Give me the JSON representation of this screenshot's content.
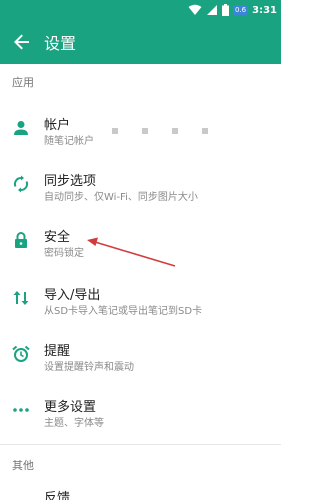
{
  "status_bar": {
    "time": "3:31",
    "badge_text": "0.6",
    "icons": [
      "wifi-icon",
      "signal-icon",
      "battery-icon"
    ]
  },
  "app_bar": {
    "title": "设置",
    "back_icon": "back-arrow-icon",
    "background": "#1aa381"
  },
  "sections": {
    "app_header": "应用",
    "other_header": "其他"
  },
  "settings": [
    {
      "id": "account",
      "icon": "person-icon",
      "title": "帐户",
      "subtitle": "随笔记帐户"
    },
    {
      "id": "sync",
      "icon": "sync-icon",
      "title": "同步选项",
      "subtitle": "自动同步、仅Wi-Fi、同步图片大小"
    },
    {
      "id": "security",
      "icon": "lock-icon",
      "title": "安全",
      "subtitle": "密码锁定"
    },
    {
      "id": "import-export",
      "icon": "import-export-icon",
      "title": "导入/导出",
      "subtitle": "从SD卡导入笔记或导出笔记到SD卡"
    },
    {
      "id": "reminder",
      "icon": "alarm-icon",
      "title": "提醒",
      "subtitle": "设置提醒铃声和震动"
    },
    {
      "id": "more",
      "icon": "more-dots-icon",
      "title": "更多设置",
      "subtitle": "主题、字体等"
    }
  ],
  "other_items": [
    {
      "id": "feedback",
      "title": "反馈"
    }
  ],
  "colors": {
    "accent": "#1aa381",
    "annotation_arrow": "#d23c3c"
  }
}
